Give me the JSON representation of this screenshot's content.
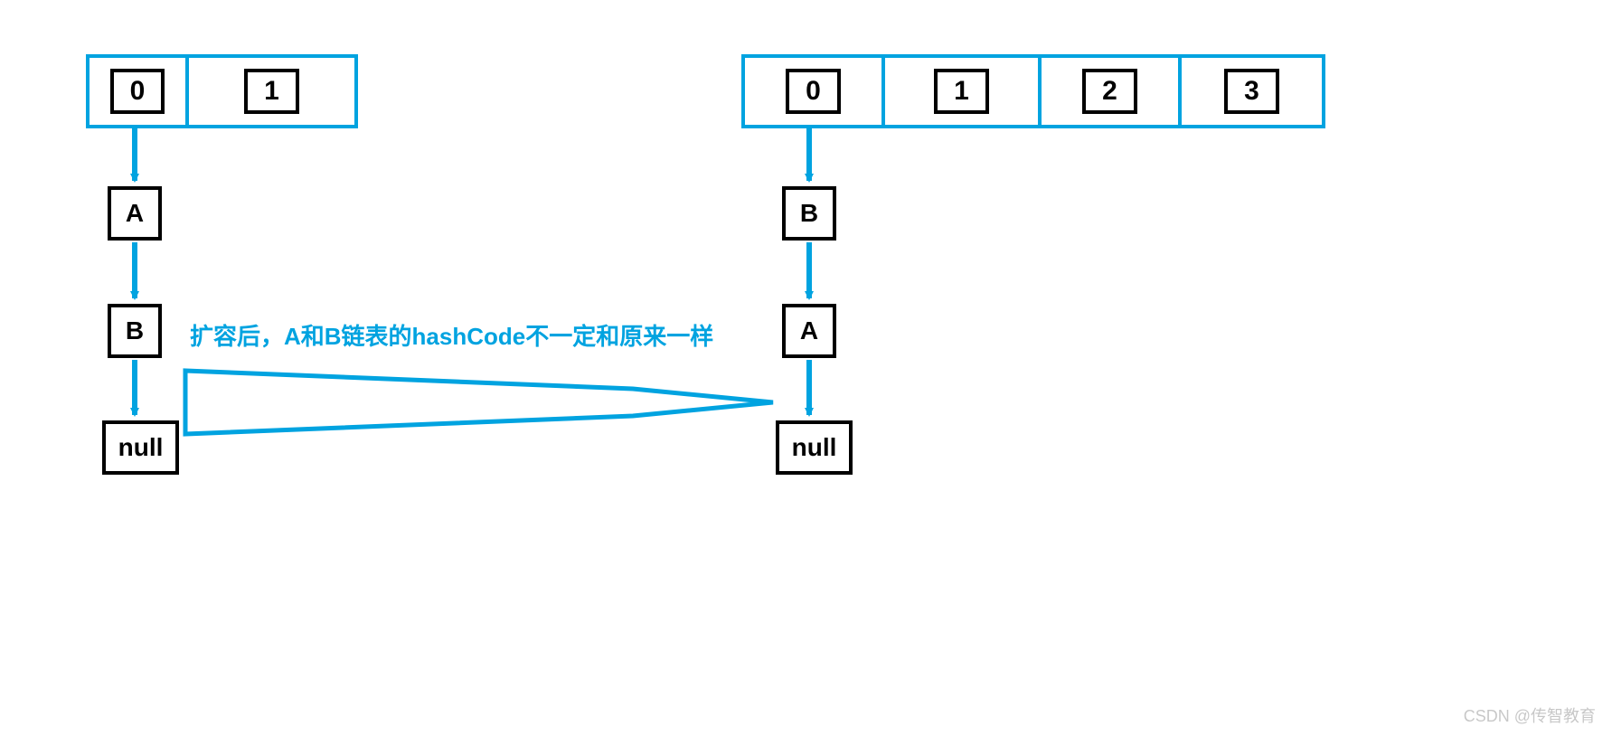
{
  "colors": {
    "accent": "#00a3e0"
  },
  "left_array": {
    "indices": [
      "0",
      "1"
    ]
  },
  "right_array": {
    "indices": [
      "0",
      "1",
      "2",
      "3"
    ]
  },
  "left_chain": {
    "nodes": [
      "A",
      "B",
      "null"
    ]
  },
  "right_chain": {
    "nodes": [
      "B",
      "A",
      "null"
    ]
  },
  "caption": "扩容后，A和B链表的hashCode不一定和原来一样",
  "watermark": "CSDN @传智教育"
}
